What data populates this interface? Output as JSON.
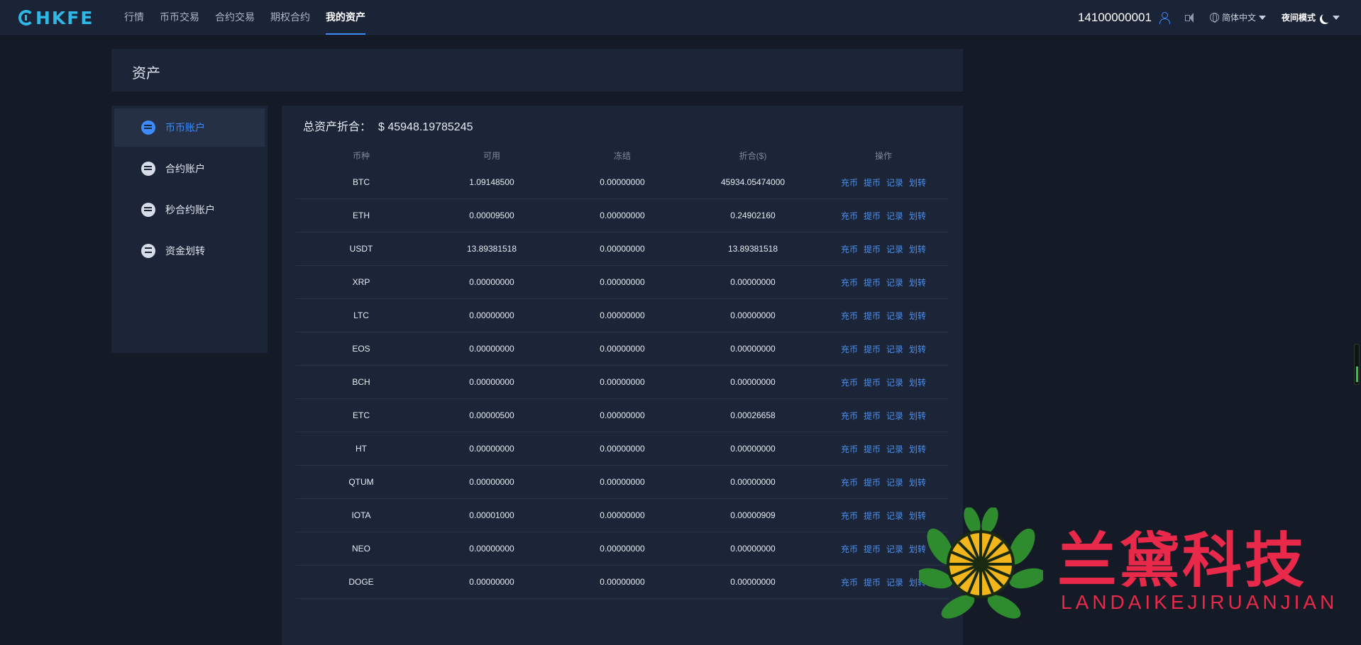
{
  "brand": {
    "name": "HKFE"
  },
  "nav": [
    {
      "label": "行情",
      "active": false
    },
    {
      "label": "币币交易",
      "active": false
    },
    {
      "label": "合约交易",
      "active": false
    },
    {
      "label": "期权合约",
      "active": false
    },
    {
      "label": "我的资产",
      "active": true
    }
  ],
  "topright": {
    "account": "14100000001",
    "language": "简体中文",
    "night_mode": "夜间模式",
    "icons": [
      "user-icon",
      "speaker-icon",
      "globe-icon",
      "moon-icon"
    ]
  },
  "page_title": "资产",
  "sidebar": [
    {
      "label": "币币账户",
      "icon": "coin-account-icon",
      "active": true
    },
    {
      "label": "合约账户",
      "icon": "contract-account-icon",
      "active": false
    },
    {
      "label": "秒合约账户",
      "icon": "second-contract-account-icon",
      "active": false
    },
    {
      "label": "资金划转",
      "icon": "transfer-icon",
      "active": false
    }
  ],
  "summary": {
    "label": "总资产折合：",
    "value": "$ 45948.19785245"
  },
  "table": {
    "headers": [
      "币种",
      "可用",
      "冻结",
      "折合($)",
      "操作"
    ],
    "operations": [
      "充币",
      "提币",
      "记录",
      "划转"
    ],
    "rows": [
      [
        "BTC",
        "1.09148500",
        "0.00000000",
        "45934.05474000"
      ],
      [
        "ETH",
        "0.00009500",
        "0.00000000",
        "0.24902160"
      ],
      [
        "USDT",
        "13.89381518",
        "0.00000000",
        "13.89381518"
      ],
      [
        "XRP",
        "0.00000000",
        "0.00000000",
        "0.00000000"
      ],
      [
        "LTC",
        "0.00000000",
        "0.00000000",
        "0.00000000"
      ],
      [
        "EOS",
        "0.00000000",
        "0.00000000",
        "0.00000000"
      ],
      [
        "BCH",
        "0.00000000",
        "0.00000000",
        "0.00000000"
      ],
      [
        "ETC",
        "0.00000500",
        "0.00000000",
        "0.00026658"
      ],
      [
        "HT",
        "0.00000000",
        "0.00000000",
        "0.00000000"
      ],
      [
        "QTUM",
        "0.00000000",
        "0.00000000",
        "0.00000000"
      ],
      [
        "IOTA",
        "0.00001000",
        "0.00000000",
        "0.00000909"
      ],
      [
        "NEO",
        "0.00000000",
        "0.00000000",
        "0.00000000"
      ],
      [
        "DOGE",
        "0.00000000",
        "0.00000000",
        "0.00000000"
      ]
    ]
  },
  "watermark": {
    "title": "兰黛科技",
    "subtitle": "LANDAIKEJIRUANJIAN"
  },
  "colors": {
    "accent": "#3d8bfd",
    "link": "#4a90f0",
    "brand": "#2fb7e6",
    "watermark": "#e8294a",
    "panel": "#1c2538",
    "background": "#141a26"
  }
}
